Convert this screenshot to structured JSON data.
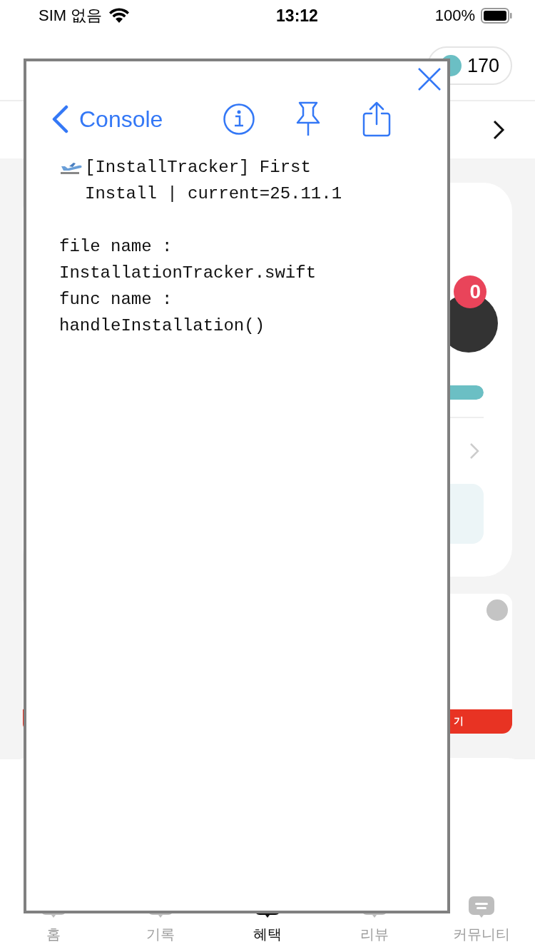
{
  "status_bar": {
    "carrier": "SIM 없음",
    "time": "13:12",
    "battery": "100%"
  },
  "header": {
    "points": "170"
  },
  "card": {
    "badge": "0",
    "progress": {
      "level": 1
    }
  },
  "ad_card": {
    "button": "기"
  },
  "tabs": [
    {
      "label": "홈",
      "selected": false
    },
    {
      "label": "기록",
      "selected": false
    },
    {
      "label": "혜택",
      "selected": true
    },
    {
      "label": "리뷰",
      "selected": false
    },
    {
      "label": "커뮤니티",
      "selected": false
    }
  ],
  "console": {
    "title": "Console",
    "log": {
      "message": "[InstallTracker] First Install | current=25.11.1",
      "file_name": "file name : InstallationTracker.swift",
      "func_name": "func name : handleInstallation()"
    }
  }
}
